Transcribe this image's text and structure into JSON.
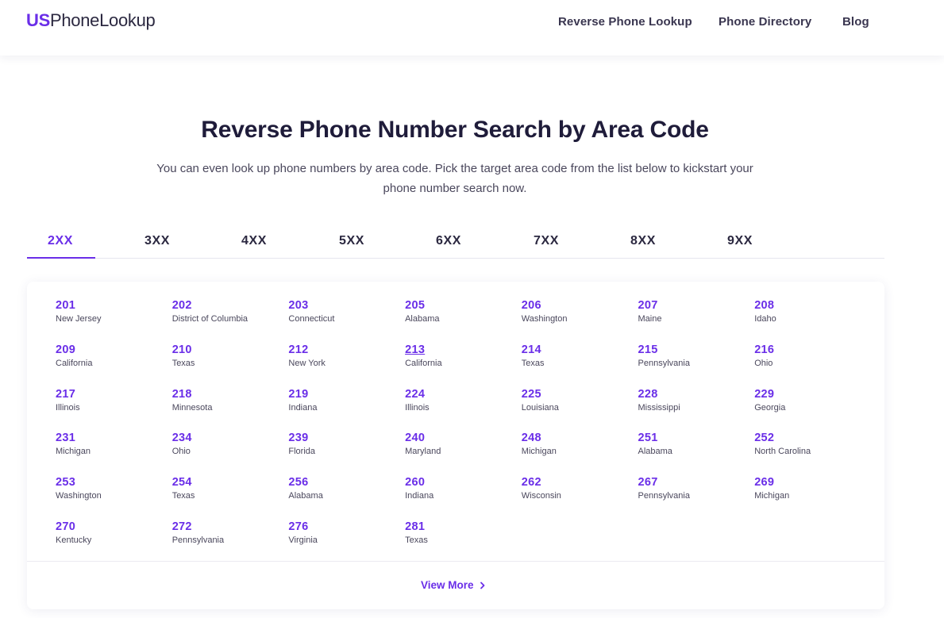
{
  "header": {
    "logo_us": "US",
    "logo_rest": "PhoneLookup",
    "nav": [
      "Reverse Phone Lookup",
      "Phone Directory",
      "Blog"
    ]
  },
  "hero": {
    "title": "Reverse Phone Number Search by Area Code",
    "subtitle": "You can even look up phone numbers by area code. Pick the target area code from the list below to kickstart your phone number search now."
  },
  "tabs": [
    "2XX",
    "3XX",
    "4XX",
    "5XX",
    "6XX",
    "7XX",
    "8XX",
    "9XX"
  ],
  "active_tab": "2XX",
  "area_codes": [
    {
      "code": "201",
      "state": "New Jersey"
    },
    {
      "code": "202",
      "state": "District of Columbia"
    },
    {
      "code": "203",
      "state": "Connecticut"
    },
    {
      "code": "205",
      "state": "Alabama"
    },
    {
      "code": "206",
      "state": "Washington"
    },
    {
      "code": "207",
      "state": "Maine"
    },
    {
      "code": "208",
      "state": "Idaho"
    },
    {
      "code": "209",
      "state": "California"
    },
    {
      "code": "210",
      "state": "Texas"
    },
    {
      "code": "212",
      "state": "New York"
    },
    {
      "code": "213",
      "state": "California"
    },
    {
      "code": "214",
      "state": "Texas"
    },
    {
      "code": "215",
      "state": "Pennsylvania"
    },
    {
      "code": "216",
      "state": "Ohio"
    },
    {
      "code": "217",
      "state": "Illinois"
    },
    {
      "code": "218",
      "state": "Minnesota"
    },
    {
      "code": "219",
      "state": "Indiana"
    },
    {
      "code": "224",
      "state": "Illinois"
    },
    {
      "code": "225",
      "state": "Louisiana"
    },
    {
      "code": "228",
      "state": "Mississippi"
    },
    {
      "code": "229",
      "state": "Georgia"
    },
    {
      "code": "231",
      "state": "Michigan"
    },
    {
      "code": "234",
      "state": "Ohio"
    },
    {
      "code": "239",
      "state": "Florida"
    },
    {
      "code": "240",
      "state": "Maryland"
    },
    {
      "code": "248",
      "state": "Michigan"
    },
    {
      "code": "251",
      "state": "Alabama"
    },
    {
      "code": "252",
      "state": "North Carolina"
    },
    {
      "code": "253",
      "state": "Washington"
    },
    {
      "code": "254",
      "state": "Texas"
    },
    {
      "code": "256",
      "state": "Alabama"
    },
    {
      "code": "260",
      "state": "Indiana"
    },
    {
      "code": "262",
      "state": "Wisconsin"
    },
    {
      "code": "267",
      "state": "Pennsylvania"
    },
    {
      "code": "269",
      "state": "Michigan"
    },
    {
      "code": "270",
      "state": "Kentucky"
    },
    {
      "code": "272",
      "state": "Pennsylvania"
    },
    {
      "code": "276",
      "state": "Virginia"
    },
    {
      "code": "281",
      "state": "Texas"
    }
  ],
  "hovered_code": "213",
  "view_more_label": "View More",
  "colors": {
    "accent": "#6a2ee8",
    "text": "#2b2840"
  }
}
